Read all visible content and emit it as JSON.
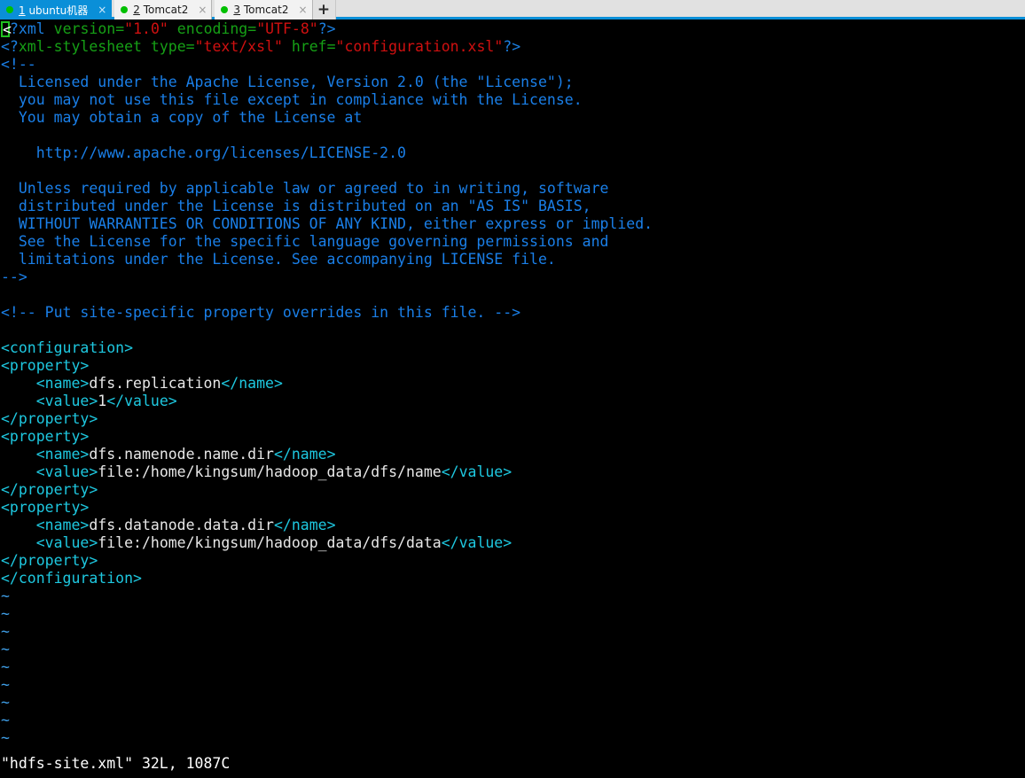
{
  "window": {
    "title": "Terminal - hdfs-site.xml",
    "accent_color": "#0a8fd8",
    "tabbar_bg": "#e1e1e1"
  },
  "tabbar": {
    "tabs": [
      {
        "number": "1",
        "label": " ubuntu机器",
        "active": true,
        "status_dot_color": "#00c000",
        "close_label": "×"
      },
      {
        "number": "2",
        "label": " Tomcat2",
        "active": false,
        "status_dot_color": "#00c000",
        "close_label": "×"
      },
      {
        "number": "3",
        "label": " Tomcat2",
        "active": false,
        "status_dot_color": "#00c000",
        "close_label": "×"
      }
    ],
    "new_tab_label": "+"
  },
  "editor": {
    "filename": "hdfs-site.xml",
    "status_line": "\"hdfs-site.xml\" 32L, 1087C",
    "line_count": "32L",
    "char_count": "1087C",
    "cursor_char": "<",
    "filler_char": "~",
    "filler_rows": 9,
    "colors": {
      "background": "#000000",
      "tag": "#1ec8e0",
      "text": "#e8e8e8",
      "comment": "#1a7fe8",
      "pi_delim": "#1b7fe0",
      "attribute": "#16a016",
      "string": "#d01010",
      "tilde": "#3f9fe8",
      "cursor_border": "#20c020"
    },
    "lines": [
      {
        "id": "l1",
        "segments": [
          {
            "t": "<",
            "c": "cursor"
          },
          {
            "t": "?xml ",
            "c": "c-pitag"
          },
          {
            "t": "version",
            "c": "c-attr"
          },
          {
            "t": "=",
            "c": "c-attr"
          },
          {
            "t": "\"1.0\"",
            "c": "c-string"
          },
          {
            "t": " ",
            "c": "c-attr"
          },
          {
            "t": "encoding",
            "c": "c-attr"
          },
          {
            "t": "=",
            "c": "c-attr"
          },
          {
            "t": "\"UTF-8\"",
            "c": "c-string"
          },
          {
            "t": "?>",
            "c": "c-pitag"
          }
        ]
      },
      {
        "id": "l2",
        "segments": [
          {
            "t": "<?",
            "c": "c-pitag"
          },
          {
            "t": "xml-stylesheet ",
            "c": "c-attr"
          },
          {
            "t": "type",
            "c": "c-attr"
          },
          {
            "t": "=",
            "c": "c-attr"
          },
          {
            "t": "\"text/xsl\"",
            "c": "c-string"
          },
          {
            "t": " ",
            "c": "c-attr"
          },
          {
            "t": "href",
            "c": "c-attr"
          },
          {
            "t": "=",
            "c": "c-attr"
          },
          {
            "t": "\"configuration.xsl\"",
            "c": "c-string"
          },
          {
            "t": "?>",
            "c": "c-pitag"
          }
        ]
      },
      {
        "id": "l3",
        "segments": [
          {
            "t": "<!--",
            "c": "c-comment"
          }
        ]
      },
      {
        "id": "l4",
        "segments": [
          {
            "t": "  Licensed under the Apache License, Version 2.0 (the \"License\");",
            "c": "c-comment"
          }
        ]
      },
      {
        "id": "l5",
        "segments": [
          {
            "t": "  you may not use this file except in compliance with the License.",
            "c": "c-comment"
          }
        ]
      },
      {
        "id": "l6",
        "segments": [
          {
            "t": "  You may obtain a copy of the License at",
            "c": "c-comment"
          }
        ]
      },
      {
        "id": "l7",
        "segments": [
          {
            "t": "",
            "c": "c-comment"
          }
        ]
      },
      {
        "id": "l8",
        "segments": [
          {
            "t": "    http://www.apache.org/licenses/LICENSE-2.0",
            "c": "c-comment"
          }
        ]
      },
      {
        "id": "l9",
        "segments": [
          {
            "t": "",
            "c": "c-comment"
          }
        ]
      },
      {
        "id": "l10",
        "segments": [
          {
            "t": "  Unless required by applicable law or agreed to in writing, software",
            "c": "c-comment"
          }
        ]
      },
      {
        "id": "l11",
        "segments": [
          {
            "t": "  distributed under the License is distributed on an \"AS IS\" BASIS,",
            "c": "c-comment"
          }
        ]
      },
      {
        "id": "l12",
        "segments": [
          {
            "t": "  WITHOUT WARRANTIES OR CONDITIONS OF ANY KIND, either express or implied.",
            "c": "c-comment"
          }
        ]
      },
      {
        "id": "l13",
        "segments": [
          {
            "t": "  See the License for the specific language governing permissions and",
            "c": "c-comment"
          }
        ]
      },
      {
        "id": "l14",
        "segments": [
          {
            "t": "  limitations under the License. See accompanying LICENSE file.",
            "c": "c-comment"
          }
        ]
      },
      {
        "id": "l15",
        "segments": [
          {
            "t": "-->",
            "c": "c-comment"
          }
        ]
      },
      {
        "id": "l16",
        "segments": [
          {
            "t": "",
            "c": "c-comment"
          }
        ]
      },
      {
        "id": "l17",
        "segments": [
          {
            "t": "<!-- Put site-specific property overrides in this file. -->",
            "c": "c-comment"
          }
        ]
      },
      {
        "id": "l18",
        "segments": [
          {
            "t": "",
            "c": "c-text"
          }
        ]
      },
      {
        "id": "l19",
        "segments": [
          {
            "t": "<configuration>",
            "c": "c-tag"
          }
        ]
      },
      {
        "id": "l20",
        "segments": [
          {
            "t": "<property>",
            "c": "c-tag"
          }
        ]
      },
      {
        "id": "l21",
        "segments": [
          {
            "t": "    <name>",
            "c": "c-tag"
          },
          {
            "t": "dfs.replication",
            "c": "c-text"
          },
          {
            "t": "</name>",
            "c": "c-tag"
          }
        ]
      },
      {
        "id": "l22",
        "segments": [
          {
            "t": "    <value>",
            "c": "c-tag"
          },
          {
            "t": "1",
            "c": "c-text"
          },
          {
            "t": "</value>",
            "c": "c-tag"
          }
        ]
      },
      {
        "id": "l23",
        "segments": [
          {
            "t": "</property>",
            "c": "c-tag"
          }
        ]
      },
      {
        "id": "l24",
        "segments": [
          {
            "t": "<property>",
            "c": "c-tag"
          }
        ]
      },
      {
        "id": "l25",
        "segments": [
          {
            "t": "    <name>",
            "c": "c-tag"
          },
          {
            "t": "dfs.namenode.name.dir",
            "c": "c-text"
          },
          {
            "t": "</name>",
            "c": "c-tag"
          }
        ]
      },
      {
        "id": "l26",
        "segments": [
          {
            "t": "    <value>",
            "c": "c-tag"
          },
          {
            "t": "file:/home/kingsum/hadoop_data/dfs/name",
            "c": "c-text"
          },
          {
            "t": "</value>",
            "c": "c-tag"
          }
        ]
      },
      {
        "id": "l27",
        "segments": [
          {
            "t": "</property>",
            "c": "c-tag"
          }
        ]
      },
      {
        "id": "l28",
        "segments": [
          {
            "t": "<property>",
            "c": "c-tag"
          }
        ]
      },
      {
        "id": "l29",
        "segments": [
          {
            "t": "    <name>",
            "c": "c-tag"
          },
          {
            "t": "dfs.datanode.data.dir",
            "c": "c-text"
          },
          {
            "t": "</name>",
            "c": "c-tag"
          }
        ]
      },
      {
        "id": "l30",
        "segments": [
          {
            "t": "    <value>",
            "c": "c-tag"
          },
          {
            "t": "file:/home/kingsum/hadoop_data/dfs/data",
            "c": "c-text"
          },
          {
            "t": "</value>",
            "c": "c-tag"
          }
        ]
      },
      {
        "id": "l31",
        "segments": [
          {
            "t": "</property>",
            "c": "c-tag"
          }
        ]
      },
      {
        "id": "l32",
        "segments": [
          {
            "t": "</configuration>",
            "c": "c-tag"
          }
        ]
      }
    ]
  }
}
